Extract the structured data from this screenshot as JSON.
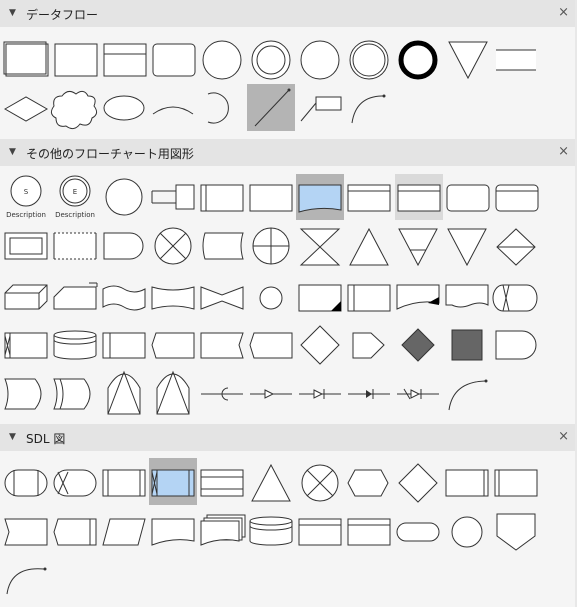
{
  "sections": [
    {
      "title": "データフロー",
      "close": "×"
    },
    {
      "title": "その他のフローチャート用図形",
      "close": "×"
    },
    {
      "title": "SDL 図",
      "close": "×"
    }
  ],
  "shape_labels": {
    "s": "S",
    "e": "E",
    "description": "Description"
  },
  "colors": {
    "header_bg": "#e4e4e4",
    "selected_bg": "#b4b4b4",
    "hover_bg": "#dadada",
    "blue_fill": "#b4d4f4",
    "dark_fill": "#666666"
  }
}
